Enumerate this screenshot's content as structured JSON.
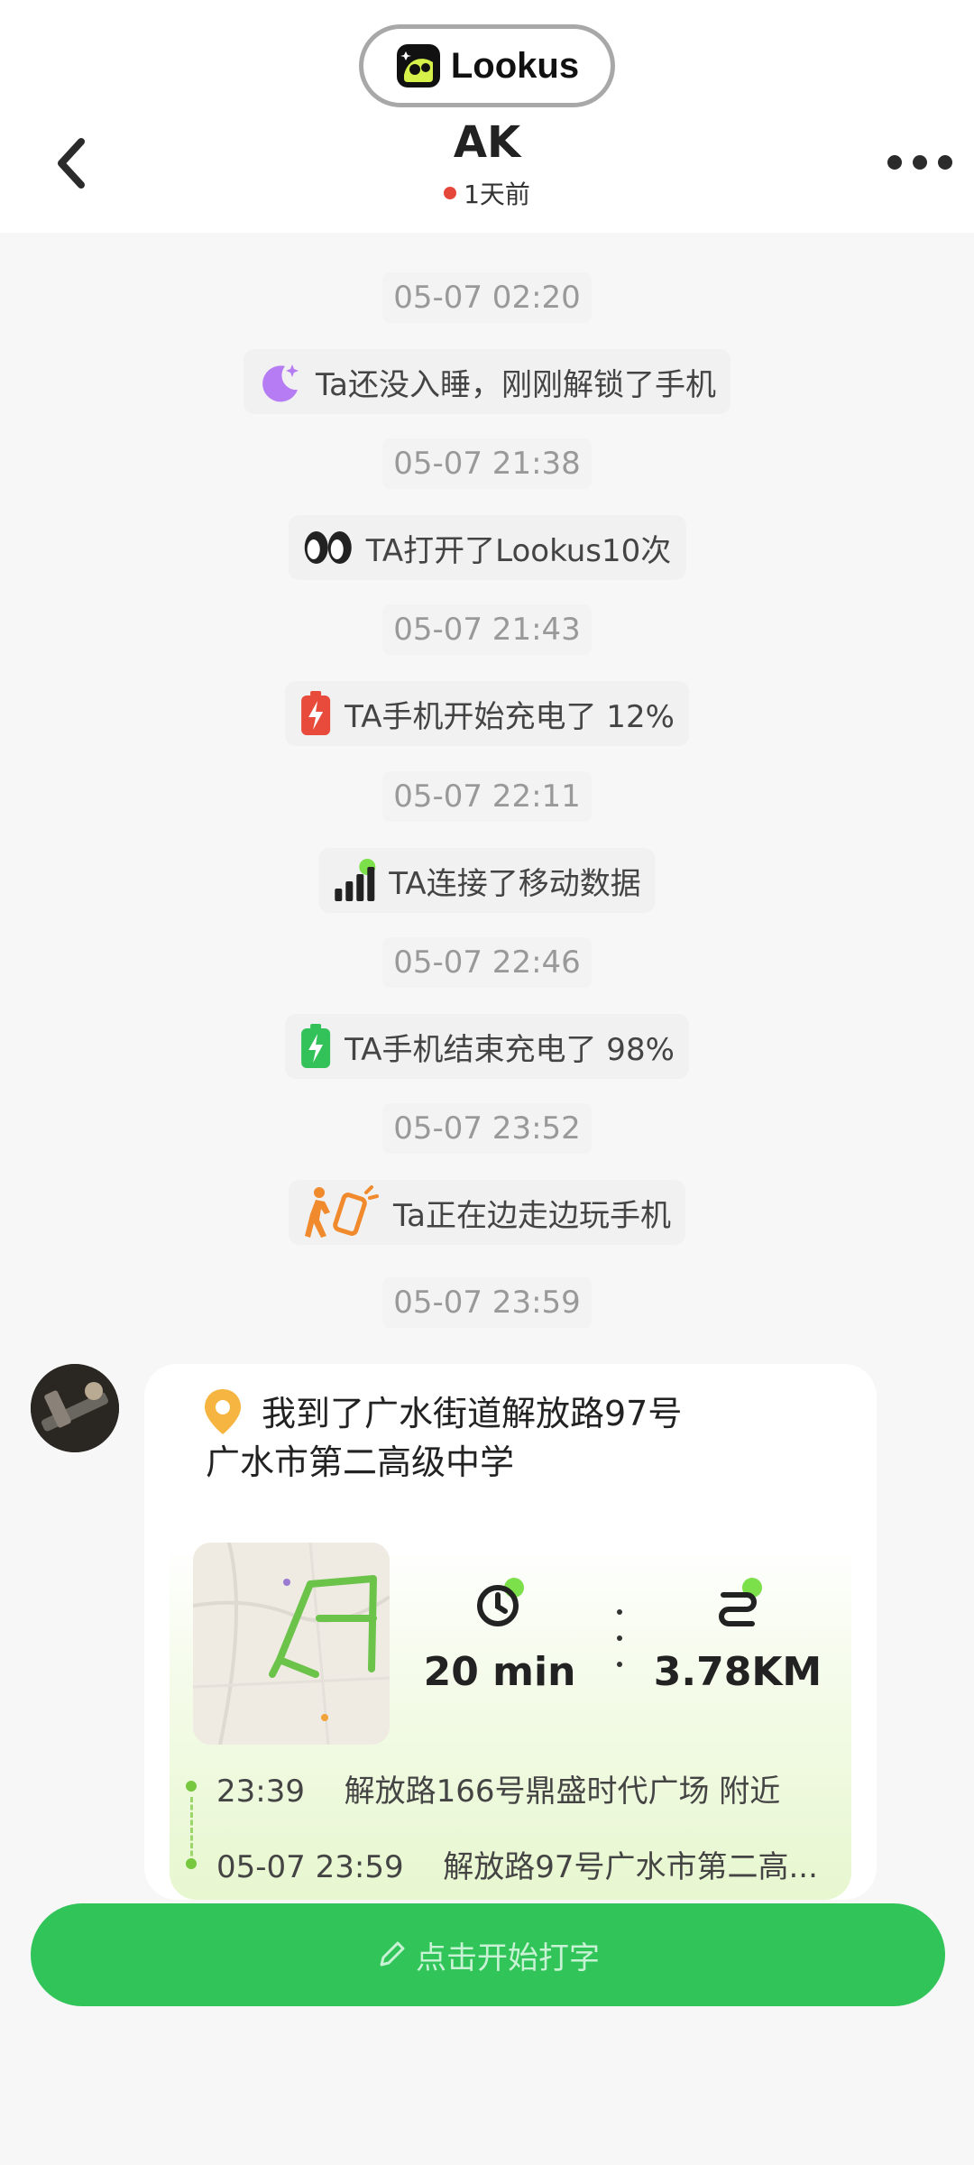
{
  "app": {
    "brand": "Lookus"
  },
  "header": {
    "title": "AK",
    "status": "1天前"
  },
  "feed": [
    {
      "time": "05-07 02:20",
      "text": "Ta还没入睡，刚刚解锁了手机",
      "icon": "moon-icon"
    },
    {
      "time": "05-07 21:38",
      "text": "TA打开了Lookus10次",
      "icon": "eyes-icon"
    },
    {
      "time": "05-07 21:43",
      "text": "TA手机开始充电了 12%",
      "icon": "battery-low-charging-icon"
    },
    {
      "time": "05-07 22:11",
      "text": "TA连接了移动数据",
      "icon": "signal-icon"
    },
    {
      "time": "05-07 22:46",
      "text": "TA手机结束充电了 98%",
      "icon": "battery-full-charging-icon"
    },
    {
      "time": "05-07 23:52",
      "text": "Ta正在边走边玩手机",
      "icon": "walking-phone-icon"
    }
  ],
  "location_card": {
    "time": "05-07 23:59",
    "title_line1": "我到了广水街道解放路97号",
    "title_line2": "广水市第二高级中学",
    "duration": "20 min",
    "distance": "3.78KM",
    "start": {
      "time": "23:39",
      "place": "解放路166号鼎盛时代广场 附近"
    },
    "end": {
      "time": "05-07 23:59",
      "place": "解放路97号广水市第二高..."
    }
  },
  "input": {
    "placeholder": "点击开始打字"
  },
  "colors": {
    "accent": "#31c459",
    "status_dot": "#e5483a",
    "route_green": "#78c83f"
  }
}
